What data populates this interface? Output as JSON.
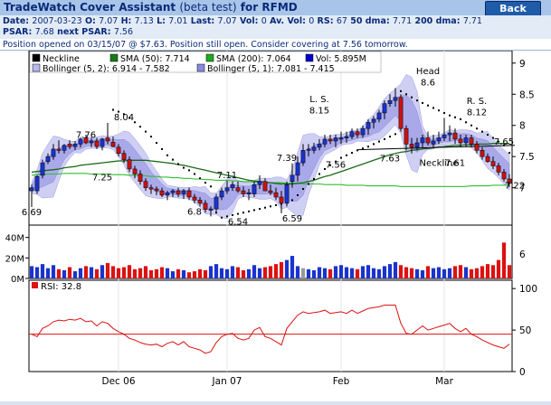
{
  "app": {
    "title_prefix": "TradeWatch Cover Assistant",
    "title_mid": "(beta test)",
    "title_for": "for",
    "symbol": "RFMD",
    "back_label": "Back"
  },
  "quote": {
    "date_label": "Date:",
    "date": "2007-03-23",
    "open_label": "O:",
    "open": "7.07",
    "high_label": "H:",
    "high": "7.13",
    "low_label": "L:",
    "low": "7.01",
    "last_label": "Last:",
    "last": "7.07",
    "vol_label": "Vol:",
    "vol": "0",
    "avvol_label": "Av. Vol:",
    "avvol": "0",
    "rs_label": "RS:",
    "rs": "67",
    "dma50_label": "50 dma:",
    "dma50": "7.71",
    "dma200_label": "200 dma:",
    "dma200": "7.71",
    "psar_label": "PSAR:",
    "psar": "7.68",
    "nextpsar_label": "next PSAR:",
    "nextpsar": "7.56"
  },
  "message": "Position opened on 03/15/07 @ $7.63. Position still open. Consider covering at 7.56 tomorrow.",
  "legend": [
    {
      "label": "Neckline",
      "color": "#000000"
    },
    {
      "label": "SMA (50): 7.714",
      "color": "#1a7a1a"
    },
    {
      "label": "SMA (200): 7.064",
      "color": "#1faa1f"
    },
    {
      "label": "Vol: 5.895M",
      "color": "#0000cc"
    },
    {
      "label": "Bollinger (5, 2): 6.914 - 7.582",
      "color": "#b8b8ee"
    },
    {
      "label": "Bollinger (5, 1): 7.081 - 7.415",
      "color": "#8a8ae0"
    }
  ],
  "chart_data": {
    "type": "candlestick",
    "dates": [
      "2006-11-13",
      "2006-11-14",
      "2006-11-15",
      "2006-11-16",
      "2006-11-17",
      "2006-11-20",
      "2006-11-21",
      "2006-11-22",
      "2006-11-24",
      "2006-11-27",
      "2006-11-28",
      "2006-11-29",
      "2006-11-30",
      "2006-12-01",
      "2006-12-04",
      "2006-12-05",
      "2006-12-06",
      "2006-12-07",
      "2006-12-08",
      "2006-12-11",
      "2006-12-12",
      "2006-12-13",
      "2006-12-14",
      "2006-12-15",
      "2006-12-18",
      "2006-12-19",
      "2006-12-20",
      "2006-12-21",
      "2006-12-22",
      "2006-12-26",
      "2006-12-27",
      "2006-12-28",
      "2006-12-29",
      "2007-01-03",
      "2007-01-04",
      "2007-01-05",
      "2007-01-08",
      "2007-01-09",
      "2007-01-10",
      "2007-01-11",
      "2007-01-12",
      "2007-01-16",
      "2007-01-17",
      "2007-01-18",
      "2007-01-19",
      "2007-01-22",
      "2007-01-23",
      "2007-01-24",
      "2007-01-25",
      "2007-01-26",
      "2007-01-29",
      "2007-01-30",
      "2007-01-31",
      "2007-02-01",
      "2007-02-02",
      "2007-02-05",
      "2007-02-06",
      "2007-02-07",
      "2007-02-08",
      "2007-02-09",
      "2007-02-12",
      "2007-02-13",
      "2007-02-14",
      "2007-02-15",
      "2007-02-16",
      "2007-02-20",
      "2007-02-21",
      "2007-02-22",
      "2007-02-23",
      "2007-02-26",
      "2007-02-27",
      "2007-02-28",
      "2007-03-01",
      "2007-03-02",
      "2007-03-05",
      "2007-03-06",
      "2007-03-07",
      "2007-03-08",
      "2007-03-09",
      "2007-03-12",
      "2007-03-13",
      "2007-03-14",
      "2007-03-15",
      "2007-03-16",
      "2007-03-19",
      "2007-03-20",
      "2007-03-21",
      "2007-03-22",
      "2007-03-23"
    ],
    "open": [
      6.95,
      6.95,
      7.2,
      7.42,
      7.5,
      7.62,
      7.6,
      7.7,
      7.66,
      7.7,
      7.8,
      7.72,
      7.75,
      7.66,
      7.8,
      7.73,
      7.65,
      7.55,
      7.45,
      7.3,
      7.22,
      7.1,
      7.0,
      6.98,
      6.95,
      6.88,
      6.92,
      6.95,
      6.9,
      6.95,
      6.85,
      6.8,
      6.75,
      6.65,
      6.66,
      6.85,
      6.95,
      7.0,
      7.0,
      6.95,
      6.9,
      6.9,
      7.05,
      7.1,
      6.95,
      6.92,
      6.85,
      6.75,
      7.1,
      7.2,
      7.4,
      7.6,
      7.6,
      7.65,
      7.7,
      7.78,
      7.75,
      7.78,
      7.8,
      7.82,
      7.9,
      7.85,
      7.95,
      8.05,
      8.1,
      8.2,
      8.35,
      8.4,
      8.45,
      7.95,
      7.7,
      7.65,
      7.72,
      7.8,
      7.7,
      7.75,
      7.8,
      7.85,
      7.88,
      7.78,
      7.72,
      7.8,
      7.7,
      7.6,
      7.5,
      7.42,
      7.35,
      7.25,
      7.14
    ],
    "high": [
      7.05,
      7.2,
      7.45,
      7.55,
      7.7,
      7.76,
      7.7,
      7.76,
      7.75,
      7.8,
      7.85,
      7.8,
      7.8,
      7.8,
      8.04,
      7.82,
      7.7,
      7.6,
      7.5,
      7.35,
      7.28,
      7.15,
      7.05,
      7.02,
      7.0,
      6.95,
      6.98,
      7.0,
      6.98,
      7.0,
      6.9,
      6.85,
      6.8,
      6.7,
      6.9,
      7.0,
      7.11,
      7.1,
      7.1,
      7.02,
      6.98,
      7.1,
      7.2,
      7.15,
      7.05,
      7.0,
      6.95,
      7.1,
      7.39,
      7.5,
      7.7,
      7.7,
      7.72,
      7.78,
      7.85,
      7.85,
      7.85,
      7.9,
      7.9,
      7.95,
      7.95,
      8.0,
      8.1,
      8.15,
      8.25,
      8.4,
      8.5,
      8.6,
      8.5,
      8.0,
      7.8,
      7.8,
      7.85,
      7.9,
      7.85,
      7.9,
      8.12,
      8.0,
      7.95,
      7.85,
      7.85,
      7.85,
      7.75,
      7.65,
      7.55,
      7.5,
      7.4,
      7.3,
      7.22
    ],
    "low": [
      6.69,
      6.9,
      7.15,
      7.38,
      7.45,
      7.55,
      7.55,
      7.62,
      7.6,
      7.65,
      7.7,
      7.65,
      7.62,
      7.6,
      7.7,
      7.65,
      7.5,
      7.4,
      7.25,
      7.15,
      7.05,
      6.95,
      6.9,
      6.88,
      6.85,
      6.8,
      6.85,
      6.85,
      6.82,
      6.8,
      6.75,
      6.7,
      6.6,
      6.54,
      6.62,
      6.8,
      6.9,
      6.95,
      6.92,
      6.85,
      6.8,
      6.85,
      6.98,
      6.95,
      6.88,
      6.8,
      6.59,
      6.7,
      7.0,
      7.1,
      7.35,
      7.5,
      7.55,
      7.6,
      7.65,
      7.7,
      7.65,
      7.7,
      7.72,
      7.78,
      7.8,
      7.8,
      7.85,
      7.95,
      8.05,
      8.1,
      8.3,
      8.3,
      7.9,
      7.6,
      7.55,
      7.6,
      7.65,
      7.68,
      7.65,
      7.7,
      7.75,
      7.75,
      7.7,
      7.65,
      7.65,
      7.65,
      7.55,
      7.45,
      7.4,
      7.3,
      7.2,
      7.1,
      7.01
    ],
    "close": [
      7.0,
      7.18,
      7.4,
      7.5,
      7.62,
      7.6,
      7.68,
      7.66,
      7.7,
      7.78,
      7.72,
      7.75,
      7.66,
      7.78,
      7.75,
      7.66,
      7.55,
      7.45,
      7.3,
      7.22,
      7.1,
      7.0,
      6.98,
      6.95,
      6.88,
      6.92,
      6.95,
      6.9,
      6.95,
      6.85,
      6.8,
      6.75,
      6.65,
      6.66,
      6.85,
      6.95,
      7.0,
      7.05,
      6.95,
      6.9,
      6.92,
      7.05,
      7.1,
      6.95,
      6.92,
      6.85,
      6.75,
      7.05,
      7.2,
      7.4,
      7.6,
      7.62,
      7.65,
      7.7,
      7.78,
      7.75,
      7.8,
      7.8,
      7.82,
      7.9,
      7.85,
      7.95,
      8.05,
      8.1,
      8.2,
      8.35,
      8.4,
      8.45,
      7.95,
      7.7,
      7.65,
      7.72,
      7.8,
      7.72,
      7.75,
      7.8,
      7.85,
      7.88,
      7.78,
      7.72,
      7.8,
      7.7,
      7.6,
      7.5,
      7.42,
      7.35,
      7.25,
      7.14,
      7.07
    ],
    "volume_m": [
      12,
      11,
      14,
      10,
      13,
      9,
      8,
      11,
      7,
      10,
      12,
      11,
      9,
      13,
      15,
      12,
      10,
      11,
      13,
      9,
      10,
      12,
      8,
      9,
      11,
      10,
      7,
      9,
      8,
      6,
      7,
      9,
      8,
      12,
      14,
      10,
      9,
      12,
      11,
      8,
      9,
      13,
      10,
      11,
      12,
      14,
      16,
      18,
      22,
      12,
      10,
      9,
      8,
      11,
      10,
      9,
      12,
      13,
      11,
      10,
      9,
      12,
      13,
      10,
      9,
      12,
      14,
      16,
      13,
      11,
      10,
      9,
      8,
      12,
      10,
      11,
      9,
      10,
      12,
      13,
      11,
      9,
      10,
      12,
      14,
      13,
      18,
      35,
      13
    ],
    "rsi": [
      45,
      42,
      52,
      55,
      60,
      62,
      61,
      63,
      62,
      64,
      60,
      61,
      55,
      60,
      58,
      52,
      48,
      45,
      40,
      38,
      35,
      33,
      32,
      33,
      30,
      34,
      36,
      32,
      36,
      30,
      28,
      26,
      22,
      24,
      35,
      42,
      45,
      46,
      40,
      38,
      40,
      50,
      53,
      42,
      40,
      36,
      32,
      52,
      60,
      68,
      72,
      70,
      71,
      72,
      74,
      70,
      71,
      72,
      70,
      74,
      70,
      73,
      76,
      77,
      78,
      80,
      80,
      80,
      58,
      46,
      45,
      50,
      55,
      50,
      52,
      54,
      56,
      58,
      52,
      48,
      52,
      45,
      42,
      38,
      35,
      32,
      30,
      28,
      33
    ],
    "sma50": [
      7.25,
      7.26,
      7.27,
      7.28,
      7.29,
      7.3,
      7.32,
      7.33,
      7.34,
      7.36,
      7.37,
      7.38,
      7.39,
      7.4,
      7.41,
      7.42,
      7.43,
      7.43,
      7.44,
      7.44,
      7.44,
      7.44,
      7.43,
      7.42,
      7.41,
      7.4,
      7.39,
      7.37,
      7.36,
      7.34,
      7.32,
      7.3,
      7.28,
      7.26,
      7.24,
      7.22,
      7.2,
      7.18,
      7.16,
      7.14,
      7.12,
      7.11,
      7.1,
      7.09,
      7.08,
      7.07,
      7.06,
      7.06,
      7.06,
      7.07,
      7.08,
      7.1,
      7.12,
      7.15,
      7.18,
      7.2,
      7.23,
      7.26,
      7.29,
      7.32,
      7.35,
      7.38,
      7.41,
      7.44,
      7.47,
      7.5,
      7.53,
      7.55,
      7.57,
      7.58,
      7.6,
      7.61,
      7.62,
      7.63,
      7.64,
      7.65,
      7.66,
      7.67,
      7.68,
      7.68,
      7.69,
      7.69,
      7.7,
      7.7,
      7.7,
      7.71,
      7.71,
      7.71,
      7.71
    ],
    "sma200": [
      7.2,
      7.21,
      7.21,
      7.22,
      7.22,
      7.22,
      7.23,
      7.23,
      7.23,
      7.23,
      7.23,
      7.22,
      7.22,
      7.22,
      7.22,
      7.21,
      7.21,
      7.21,
      7.2,
      7.2,
      7.19,
      7.19,
      7.18,
      7.18,
      7.17,
      7.17,
      7.16,
      7.16,
      7.15,
      7.15,
      7.14,
      7.14,
      7.13,
      7.13,
      7.12,
      7.12,
      7.12,
      7.11,
      7.11,
      7.1,
      7.1,
      7.09,
      7.09,
      7.09,
      7.08,
      7.08,
      7.08,
      7.07,
      7.07,
      7.07,
      7.06,
      7.06,
      7.06,
      7.06,
      7.05,
      7.05,
      7.05,
      7.05,
      7.04,
      7.04,
      7.04,
      7.04,
      7.03,
      7.03,
      7.03,
      7.03,
      7.03,
      7.03,
      7.02,
      7.02,
      7.02,
      7.02,
      7.02,
      7.02,
      7.02,
      7.02,
      7.02,
      7.02,
      7.02,
      7.02,
      7.02,
      7.03,
      7.03,
      7.03,
      7.03,
      7.04,
      7.04,
      7.04,
      7.06
    ],
    "psar": [
      null,
      null,
      null,
      null,
      null,
      null,
      null,
      null,
      null,
      null,
      null,
      null,
      null,
      null,
      null,
      8.25,
      8.22,
      8.18,
      8.12,
      8.05,
      7.98,
      7.9,
      7.82,
      7.72,
      7.62,
      7.52,
      7.45,
      7.38,
      7.32,
      7.28,
      7.22,
      7.15,
      7.08,
      7.02,
      6.6,
      6.52,
      6.54,
      6.56,
      6.58,
      6.6,
      6.62,
      6.64,
      6.66,
      6.68,
      6.7,
      6.72,
      6.74,
      6.76,
      6.8,
      6.88,
      6.98,
      7.06,
      7.14,
      7.22,
      7.3,
      7.36,
      7.42,
      7.48,
      7.52,
      7.56,
      7.6,
      7.63,
      7.66,
      7.7,
      7.74,
      7.78,
      7.82,
      7.86,
      8.55,
      8.5,
      8.45,
      8.4,
      8.36,
      8.32,
      8.28,
      8.24,
      8.2,
      8.16,
      8.13,
      8.1,
      8.05,
      8.0,
      7.95,
      7.9,
      7.85,
      7.8,
      7.74,
      7.68,
      7.56
    ],
    "neckline": [
      [
        60,
        7.61
      ],
      [
        89,
        7.68
      ]
    ],
    "price_axis": {
      "min": 6.4,
      "max": 9.2,
      "ticks": [
        7,
        7.5,
        8,
        8.5,
        9
      ]
    },
    "price_axis_lower": {
      "ticks": [
        6
      ]
    },
    "volume_axis": {
      "ticks": [
        "0M",
        "20M",
        "40M"
      ],
      "values": [
        0,
        20,
        40
      ],
      "max": 45
    },
    "rsi_axis": {
      "ticks": [
        0,
        50,
        100
      ],
      "min": 0,
      "max": 110,
      "level": 45
    },
    "x_ticks": [
      {
        "label": "Dec 06",
        "i": 16
      },
      {
        "label": "Jan 07",
        "i": 36
      },
      {
        "label": "Feb",
        "i": 57
      },
      {
        "label": "Mar",
        "i": 76
      }
    ],
    "rsi_label": "RSI: 32.8",
    "annotations": [
      {
        "text": "6.69",
        "i": 0,
        "y": 6.69,
        "pos": "below"
      },
      {
        "text": "7.76",
        "i": 10,
        "y": 7.76,
        "pos": "above"
      },
      {
        "text": "7.25",
        "i": 13,
        "y": 7.25,
        "pos": "below"
      },
      {
        "text": "8.04",
        "i": 17,
        "y": 8.04,
        "pos": "above"
      },
      {
        "text": "6.8",
        "i": 30,
        "y": 6.7,
        "pos": "below"
      },
      {
        "text": "7.11",
        "i": 36,
        "y": 7.11,
        "pos": "above"
      },
      {
        "text": "6.54",
        "i": 38,
        "y": 6.54,
        "pos": "below"
      },
      {
        "text": "7.39",
        "i": 47,
        "y": 7.39,
        "pos": "above"
      },
      {
        "text": "6.59",
        "i": 48,
        "y": 6.59,
        "pos": "below"
      },
      {
        "text": "L. S.",
        "i": 53,
        "y": 8.33,
        "pos": "above"
      },
      {
        "text": "8.15",
        "i": 53,
        "y": 8.15,
        "pos": "above"
      },
      {
        "text": "7.56",
        "i": 56,
        "y": 7.45,
        "pos": "below"
      },
      {
        "text": "7.63",
        "i": 66,
        "y": 7.55,
        "pos": "below"
      },
      {
        "text": "Head",
        "i": 73,
        "y": 8.78,
        "pos": "above"
      },
      {
        "text": "8.6",
        "i": 73,
        "y": 8.6,
        "pos": "above"
      },
      {
        "text": "Neckline",
        "i": 75,
        "y": 7.48,
        "pos": "below"
      },
      {
        "text": "7.61",
        "i": 78,
        "y": 7.48,
        "pos": "below"
      },
      {
        "text": "R. S.",
        "i": 82,
        "y": 8.3,
        "pos": "above"
      },
      {
        "text": "8.12",
        "i": 82,
        "y": 8.12,
        "pos": "above"
      },
      {
        "text": "7.65",
        "i": 87,
        "y": 7.65,
        "pos": "above"
      },
      {
        "text": "7.22",
        "i": 89,
        "y": 7.12,
        "pos": "below"
      }
    ]
  }
}
